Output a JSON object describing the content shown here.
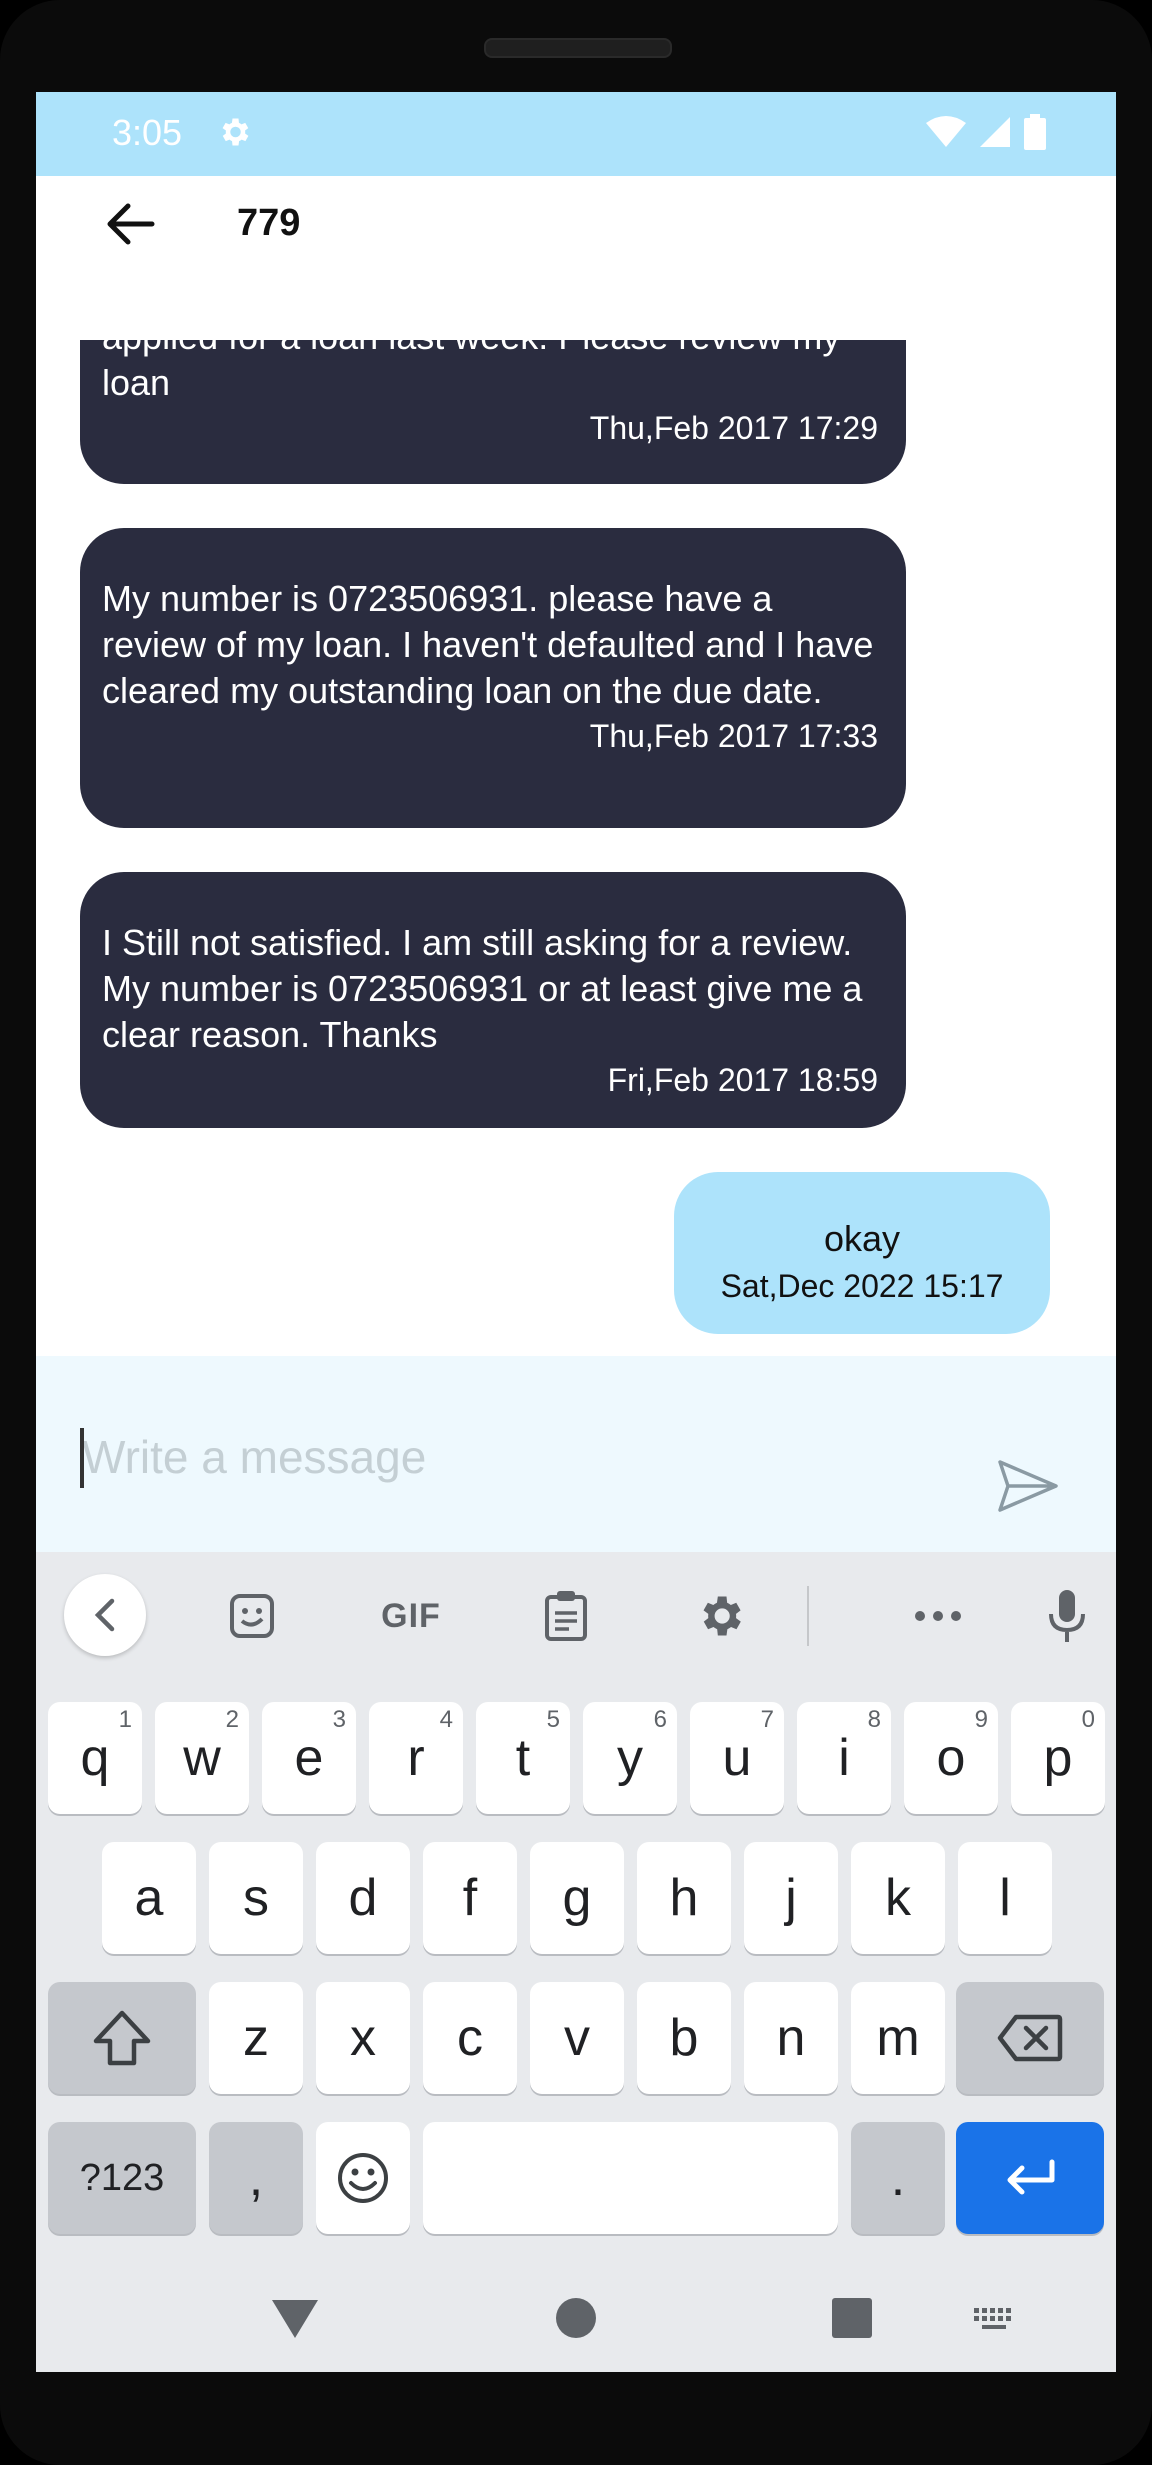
{
  "status_bar": {
    "time": "3:05",
    "bg_color": "#ade3fb"
  },
  "header": {
    "title": "779",
    "back_icon": "arrow-back-icon"
  },
  "messages": [
    {
      "direction": "incoming",
      "text": "applied for a loan last week. Please review my loan",
      "time": "Thu,Feb 2017 17:29"
    },
    {
      "direction": "incoming",
      "text": "My number is 0723506931. please have a review of my loan. I haven't defaulted and I have cleared my outstanding loan on the due date.",
      "time": "Thu,Feb 2017 17:33"
    },
    {
      "direction": "incoming",
      "text": "I Still not satisfied. I am still asking for a review.  My number is 0723506931 or at least give me a clear reason.  Thanks",
      "time": "Fri,Feb 2017 18:59"
    },
    {
      "direction": "outgoing",
      "text": "okay",
      "time": "Sat,Dec 2022 15:17"
    }
  ],
  "compose": {
    "placeholder": "Write a message",
    "value": "",
    "send_icon": "send-icon"
  },
  "keyboard": {
    "toolbar": {
      "gif_label": "GIF",
      "icons": [
        "chevron-left-icon",
        "sticker-icon",
        "clipboard-icon",
        "settings-icon",
        "more-icon",
        "microphone-icon"
      ]
    },
    "row1": [
      {
        "label": "q",
        "hint": "1"
      },
      {
        "label": "w",
        "hint": "2"
      },
      {
        "label": "e",
        "hint": "3"
      },
      {
        "label": "r",
        "hint": "4"
      },
      {
        "label": "t",
        "hint": "5"
      },
      {
        "label": "y",
        "hint": "6"
      },
      {
        "label": "u",
        "hint": "7"
      },
      {
        "label": "i",
        "hint": "8"
      },
      {
        "label": "o",
        "hint": "9"
      },
      {
        "label": "p",
        "hint": "0"
      }
    ],
    "row2": [
      "a",
      "s",
      "d",
      "f",
      "g",
      "h",
      "j",
      "k",
      "l"
    ],
    "row3": [
      "z",
      "x",
      "c",
      "v",
      "b",
      "n",
      "m"
    ],
    "symbols_label": "?123",
    "comma_label": ",",
    "period_label": ".",
    "accent_color": "#1a73e8"
  },
  "colors": {
    "incoming_bubble": "#2a2c3f",
    "outgoing_bubble": "#ade3fb",
    "compose_bg": "#eef9fe"
  }
}
